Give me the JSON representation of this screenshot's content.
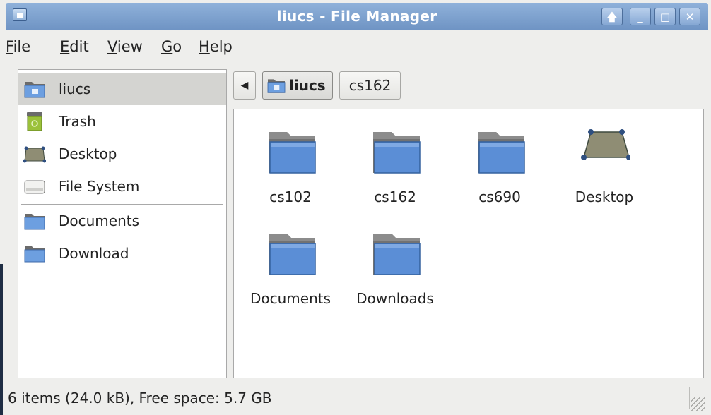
{
  "window": {
    "title": "liucs - File Manager"
  },
  "titlebar_buttons": [
    {
      "name": "keep-above-button",
      "glyph": "🡅"
    },
    {
      "name": "minimize-button",
      "glyph": "_"
    },
    {
      "name": "maximize-button",
      "glyph": "□"
    },
    {
      "name": "close-button",
      "glyph": "✕"
    }
  ],
  "menu": {
    "file": {
      "mnemonic": "F",
      "rest": "ile"
    },
    "edit": {
      "mnemonic": "E",
      "rest": "dit"
    },
    "view": {
      "mnemonic": "V",
      "rest": "iew"
    },
    "go": {
      "mnemonic": "G",
      "rest": "o"
    },
    "help": {
      "mnemonic": "H",
      "rest": "elp"
    }
  },
  "sidebar": {
    "items": [
      {
        "label": "liucs",
        "icon": "home-folder-icon",
        "selected": true
      },
      {
        "label": "Trash",
        "icon": "trash-icon"
      },
      {
        "label": "Desktop",
        "icon": "desktop-icon"
      },
      {
        "label": "File System",
        "icon": "drive-icon"
      },
      {
        "label": "Documents",
        "icon": "folder-icon"
      },
      {
        "label": "Download",
        "icon": "folder-icon"
      }
    ]
  },
  "pathbar": {
    "back": "◀",
    "crumbs": [
      {
        "label": "liucs",
        "icon": "home-folder-icon",
        "active": true
      },
      {
        "label": "cs162"
      }
    ]
  },
  "files": [
    {
      "label": "cs102",
      "icon": "folder-icon"
    },
    {
      "label": "cs162",
      "icon": "folder-icon"
    },
    {
      "label": "cs690",
      "icon": "folder-icon"
    },
    {
      "label": "Desktop",
      "icon": "desktop-icon"
    },
    {
      "label": "Documents",
      "icon": "folder-icon"
    },
    {
      "label": "Downloads",
      "icon": "folder-icon"
    }
  ],
  "status": {
    "text": "6 items (24.0 kB), Free space: 5.7 GB"
  },
  "colors": {
    "titlebar": "#7a9ecc",
    "folder": "#5b8ed6",
    "selection": "#d4d4d1"
  }
}
